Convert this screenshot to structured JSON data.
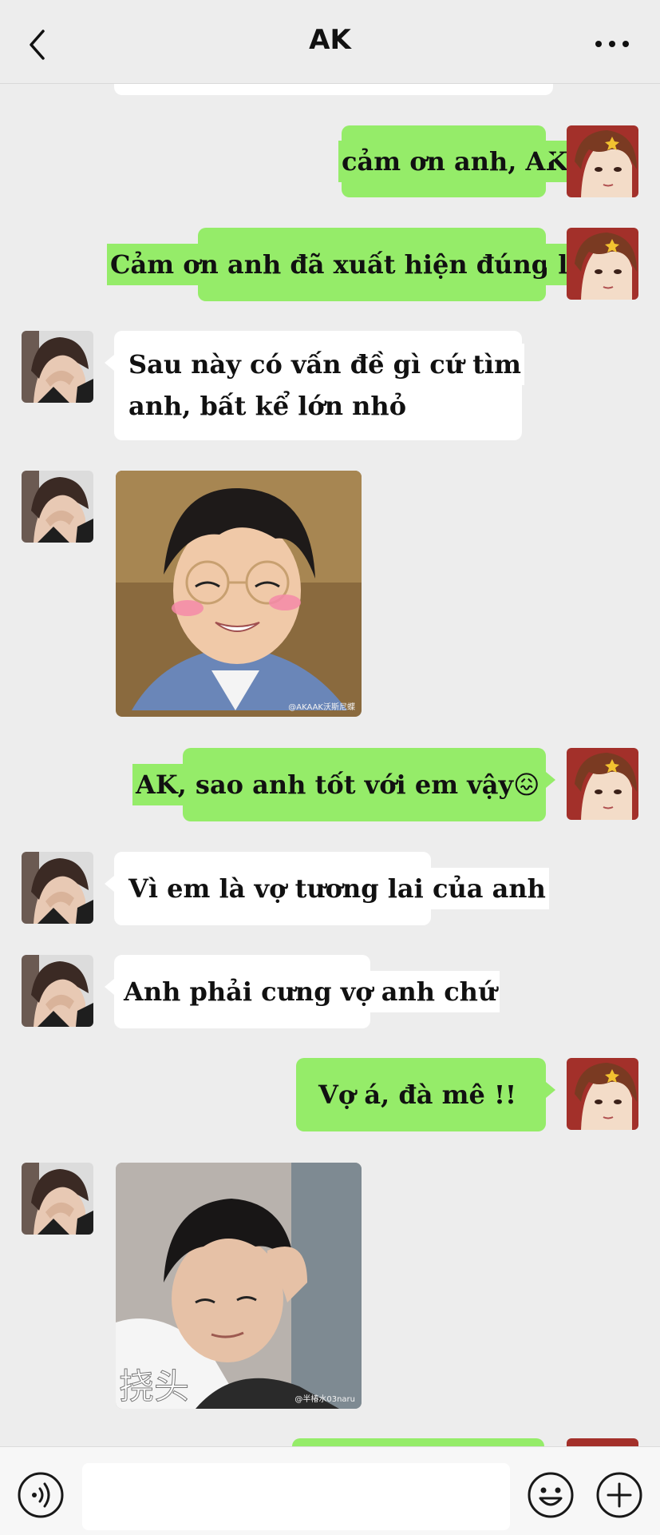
{
  "header": {
    "title": "AK",
    "back_icon": "chevron-left-icon",
    "more_icon": "more-dots-icon"
  },
  "colors": {
    "sent_bubble": "#95ec69",
    "received_bubble": "#ffffff",
    "background": "#ededed",
    "avatar_red": "#a3302a"
  },
  "messages": [
    {
      "from": "me",
      "type": "text",
      "text": "cảm ơn anh, AK"
    },
    {
      "from": "me",
      "type": "text",
      "text": "Cảm ơn anh đã xuất hiện đúng lúc"
    },
    {
      "from": "ak",
      "type": "text",
      "line1": "Sau này có vấn đề gì cứ tìm",
      "line2": "anh, bất kể lớn nhỏ"
    },
    {
      "from": "ak",
      "type": "sticker",
      "watermark": "@AKAAK沃斯尼蝶"
    },
    {
      "from": "me",
      "type": "text",
      "text": "AK, sao anh tốt với em vậy",
      "emoji": "😖"
    },
    {
      "from": "ak",
      "type": "text",
      "text": "Vì em là vợ tương lai của anh"
    },
    {
      "from": "ak",
      "type": "text",
      "text": "Anh phải cưng vợ anh chứ"
    },
    {
      "from": "me",
      "type": "text",
      "text": "Vợ á, đà mê !!"
    },
    {
      "from": "ak",
      "type": "sticker",
      "caption": "挠头",
      "watermark": "@半椿水03naru"
    }
  ],
  "inputbar": {
    "placeholder": "",
    "voice_icon": "voice-icon",
    "emoji_icon": "emoji-icon",
    "plus_icon": "plus-icon"
  }
}
